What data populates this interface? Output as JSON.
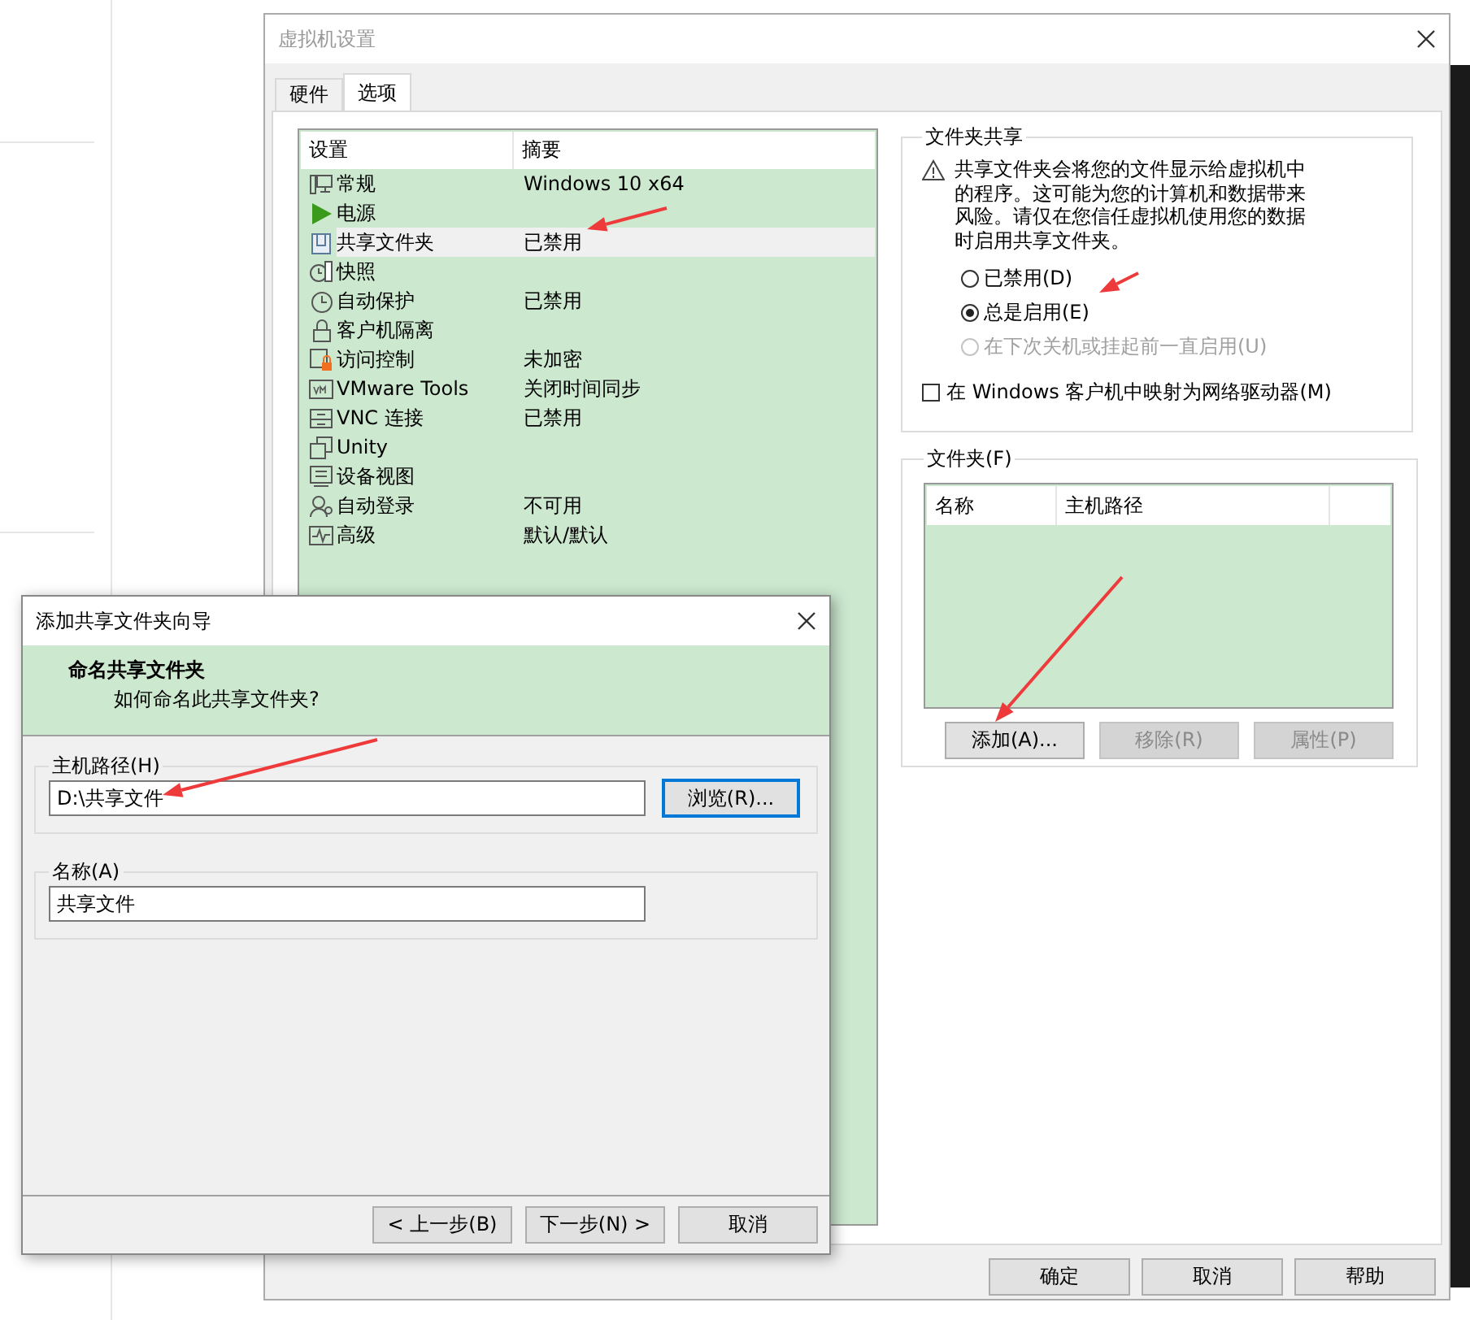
{
  "main_dialog": {
    "title": "虚拟机设置",
    "tabs": [
      {
        "label": "硬件",
        "selected": false
      },
      {
        "label": "选项",
        "selected": true
      }
    ],
    "settings_list": {
      "columns": [
        "设置",
        "摘要"
      ],
      "rows": [
        {
          "name": "常规",
          "summary": "Windows 10 x64",
          "selected": false
        },
        {
          "name": "电源",
          "selected": false
        },
        {
          "name": "共享文件夹",
          "summary": "已禁用",
          "selected": true
        },
        {
          "name": "快照",
          "selected": false
        },
        {
          "name": "自动保护",
          "summary": "已禁用",
          "selected": false
        },
        {
          "name": "客户机隔离",
          "selected": false
        },
        {
          "name": "访问控制",
          "summary": "未加密",
          "selected": false
        },
        {
          "name": "VMware Tools",
          "summary": "关闭时间同步",
          "selected": false
        },
        {
          "name": "VNC 连接",
          "summary": "已禁用",
          "selected": false
        },
        {
          "name": "Unity",
          "selected": false
        },
        {
          "name": "设备视图",
          "selected": false
        },
        {
          "name": "自动登录",
          "summary": "不可用",
          "selected": false
        },
        {
          "name": "高级",
          "summary": "默认/默认",
          "selected": false
        }
      ]
    },
    "sharing_group": {
      "title": "文件夹共享",
      "warning": "共享文件夹会将您的文件显示给虚拟机中的程序。这可能为您的计算机和数据带来风险。请仅在您信任虚拟机使用您的数据时启用共享文件夹。",
      "options": [
        {
          "label": "已禁用(D)",
          "selected": false,
          "disabled": false
        },
        {
          "label": "总是启用(E)",
          "selected": true,
          "disabled": false
        },
        {
          "label": "在下次关机或挂起前一直启用(U)",
          "selected": false,
          "disabled": true
        }
      ],
      "map_drive": {
        "label": "在 Windows 客户机中映射为网络驱动器(M)",
        "checked": false
      }
    },
    "folders_group": {
      "title": "文件夹(F)",
      "columns": [
        "名称",
        "主机路径"
      ],
      "buttons": [
        {
          "label": "添加(A)...",
          "disabled": false
        },
        {
          "label": "移除(R)",
          "disabled": true
        },
        {
          "label": "属性(P)",
          "disabled": true
        }
      ]
    },
    "buttons": [
      "确定",
      "取消",
      "帮助"
    ]
  },
  "wizard": {
    "title": "添加共享文件夹向导",
    "heading": "命名共享文件夹",
    "subheading": "如何命名此共享文件夹?",
    "host_path": {
      "label": "主机路径(H)",
      "value": "D:\\共享文件",
      "browse_button": "浏览(R)..."
    },
    "name": {
      "label": "名称(A)",
      "value": "共享文件"
    },
    "buttons": [
      "< 上一步(B)",
      "下一步(N) >",
      "取消"
    ]
  }
}
